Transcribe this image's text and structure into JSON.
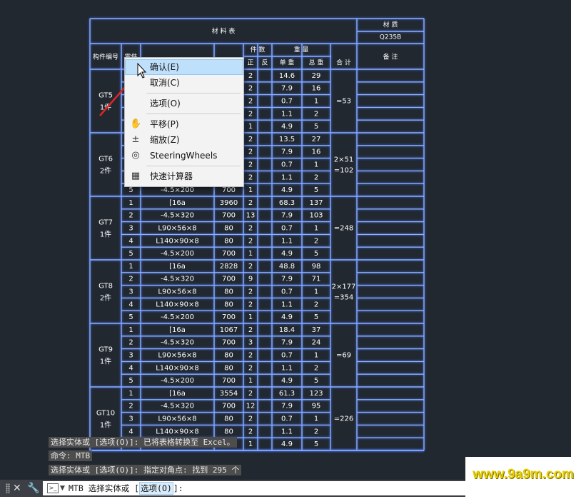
{
  "table": {
    "title": "材 料 表",
    "material_header": "材 质",
    "material": "Q235B",
    "col_part_no": "构件编号",
    "col_part_no_short": "零件",
    "col_count_header": "件 数",
    "col_count_pos": "正",
    "col_count_neg": "反",
    "col_weight_header": "重 量",
    "col_unit_weight": "单 重",
    "col_total_weight": "总 重",
    "col_sum": "合 计",
    "col_remark": "备 注",
    "groups": [
      {
        "name": "GT5",
        "qty": "1件",
        "sum": "=53",
        "rows": [
          [
            "1",
            "",
            "",
            "2",
            "14.6",
            "29"
          ],
          [
            "2",
            "",
            "",
            "2",
            "7.9",
            "16"
          ],
          [
            "3",
            "",
            "",
            "2",
            "0.7",
            "1"
          ],
          [
            "4",
            "",
            "",
            "2",
            "1.1",
            "2"
          ],
          [
            "5",
            "",
            "",
            "1",
            "4.9",
            "5"
          ]
        ]
      },
      {
        "name": "GT6",
        "qty": "2件",
        "sum": "2×51",
        "sum2": "=102",
        "rows": [
          [
            "1",
            "",
            "",
            "2",
            "13.5",
            "27"
          ],
          [
            "2",
            "",
            "",
            "2",
            "7.9",
            "16"
          ],
          [
            "3",
            "",
            "",
            "2",
            "0.7",
            "1"
          ],
          [
            "4",
            "",
            "",
            "2",
            "1.1",
            "2"
          ],
          [
            "5",
            "-4.5×200",
            "700",
            "1",
            "4.9",
            "5"
          ]
        ]
      },
      {
        "name": "GT7",
        "qty": "1件",
        "sum": "=248",
        "rows": [
          [
            "1",
            "[16a",
            "3960",
            "2",
            "68.3",
            "137"
          ],
          [
            "2",
            "-4.5×320",
            "700",
            "13",
            "7.9",
            "103"
          ],
          [
            "3",
            "L90×56×8",
            "80",
            "2",
            "0.7",
            "1"
          ],
          [
            "4",
            "L140×90×8",
            "80",
            "2",
            "1.1",
            "2"
          ],
          [
            "5",
            "-4.5×200",
            "700",
            "1",
            "4.9",
            "5"
          ]
        ]
      },
      {
        "name": "GT8",
        "qty": "2件",
        "sum": "2×177",
        "sum2": "=354",
        "rows": [
          [
            "1",
            "[16a",
            "2828",
            "2",
            "48.8",
            "98"
          ],
          [
            "2",
            "-4.5×320",
            "700",
            "9",
            "7.9",
            "71"
          ],
          [
            "3",
            "L90×56×8",
            "80",
            "2",
            "0.7",
            "1"
          ],
          [
            "4",
            "L140×90×8",
            "80",
            "2",
            "1.1",
            "2"
          ],
          [
            "5",
            "-4.5×200",
            "700",
            "1",
            "4.9",
            "5"
          ]
        ]
      },
      {
        "name": "GT9",
        "qty": "1件",
        "sum": "=69",
        "rows": [
          [
            "1",
            "[16a",
            "1067",
            "2",
            "18.4",
            "37"
          ],
          [
            "2",
            "-4.5×320",
            "700",
            "3",
            "7.9",
            "24"
          ],
          [
            "3",
            "L90×56×8",
            "80",
            "2",
            "0.7",
            "1"
          ],
          [
            "4",
            "L140×90×8",
            "80",
            "2",
            "1.1",
            "2"
          ],
          [
            "5",
            "-4.5×200",
            "700",
            "1",
            "4.9",
            "5"
          ]
        ]
      },
      {
        "name": "GT10",
        "qty": "1件",
        "sum": "=226",
        "rows": [
          [
            "1",
            "[16a",
            "3554",
            "2",
            "61.3",
            "123"
          ],
          [
            "2",
            "-4.5×320",
            "700",
            "12",
            "7.9",
            "95"
          ],
          [
            "3",
            "L90×56×8",
            "80",
            "2",
            "0.7",
            "1"
          ],
          [
            "4",
            "L140×90×8",
            "80",
            "2",
            "1.1",
            "2"
          ],
          [
            "5",
            "-4.5×200",
            "700",
            "1",
            "4.9",
            "5"
          ]
        ]
      }
    ]
  },
  "context_menu": {
    "items": [
      {
        "label": "确认(E)",
        "icon": "",
        "icon_name": "",
        "highlighted": true
      },
      {
        "label": "取消(C)",
        "icon": "",
        "icon_name": ""
      },
      {
        "label": "选项(O)",
        "icon": "",
        "icon_name": ""
      },
      {
        "label": "平移(P)",
        "icon": "✋",
        "icon_name": "pan-hand-icon"
      },
      {
        "label": "缩放(Z)",
        "icon": "±",
        "icon_name": "zoom-icon"
      },
      {
        "label": "SteeringWheels",
        "icon": "◎",
        "icon_name": "steeringwheels-icon"
      },
      {
        "label": "快速计算器",
        "icon": "▦",
        "icon_name": "calculator-icon"
      }
    ]
  },
  "command_history": [
    "选择实体或 [选项(O)]: 已将表格转换至 Excel。",
    "命令: MTB",
    "选择实体或 [选项(O)]: 指定对角点: 找到 295 个"
  ],
  "command_line": {
    "prefix": "MTB 选择实体或 [",
    "option": "选项(O)",
    "suffix": "]:"
  },
  "watermark": "www.9a9m.com",
  "colors": {
    "canvas_bg": "#212830",
    "table_line": "#8fb0ff",
    "annotation_arrow": "#e02424",
    "watermark": "#e8d000"
  }
}
